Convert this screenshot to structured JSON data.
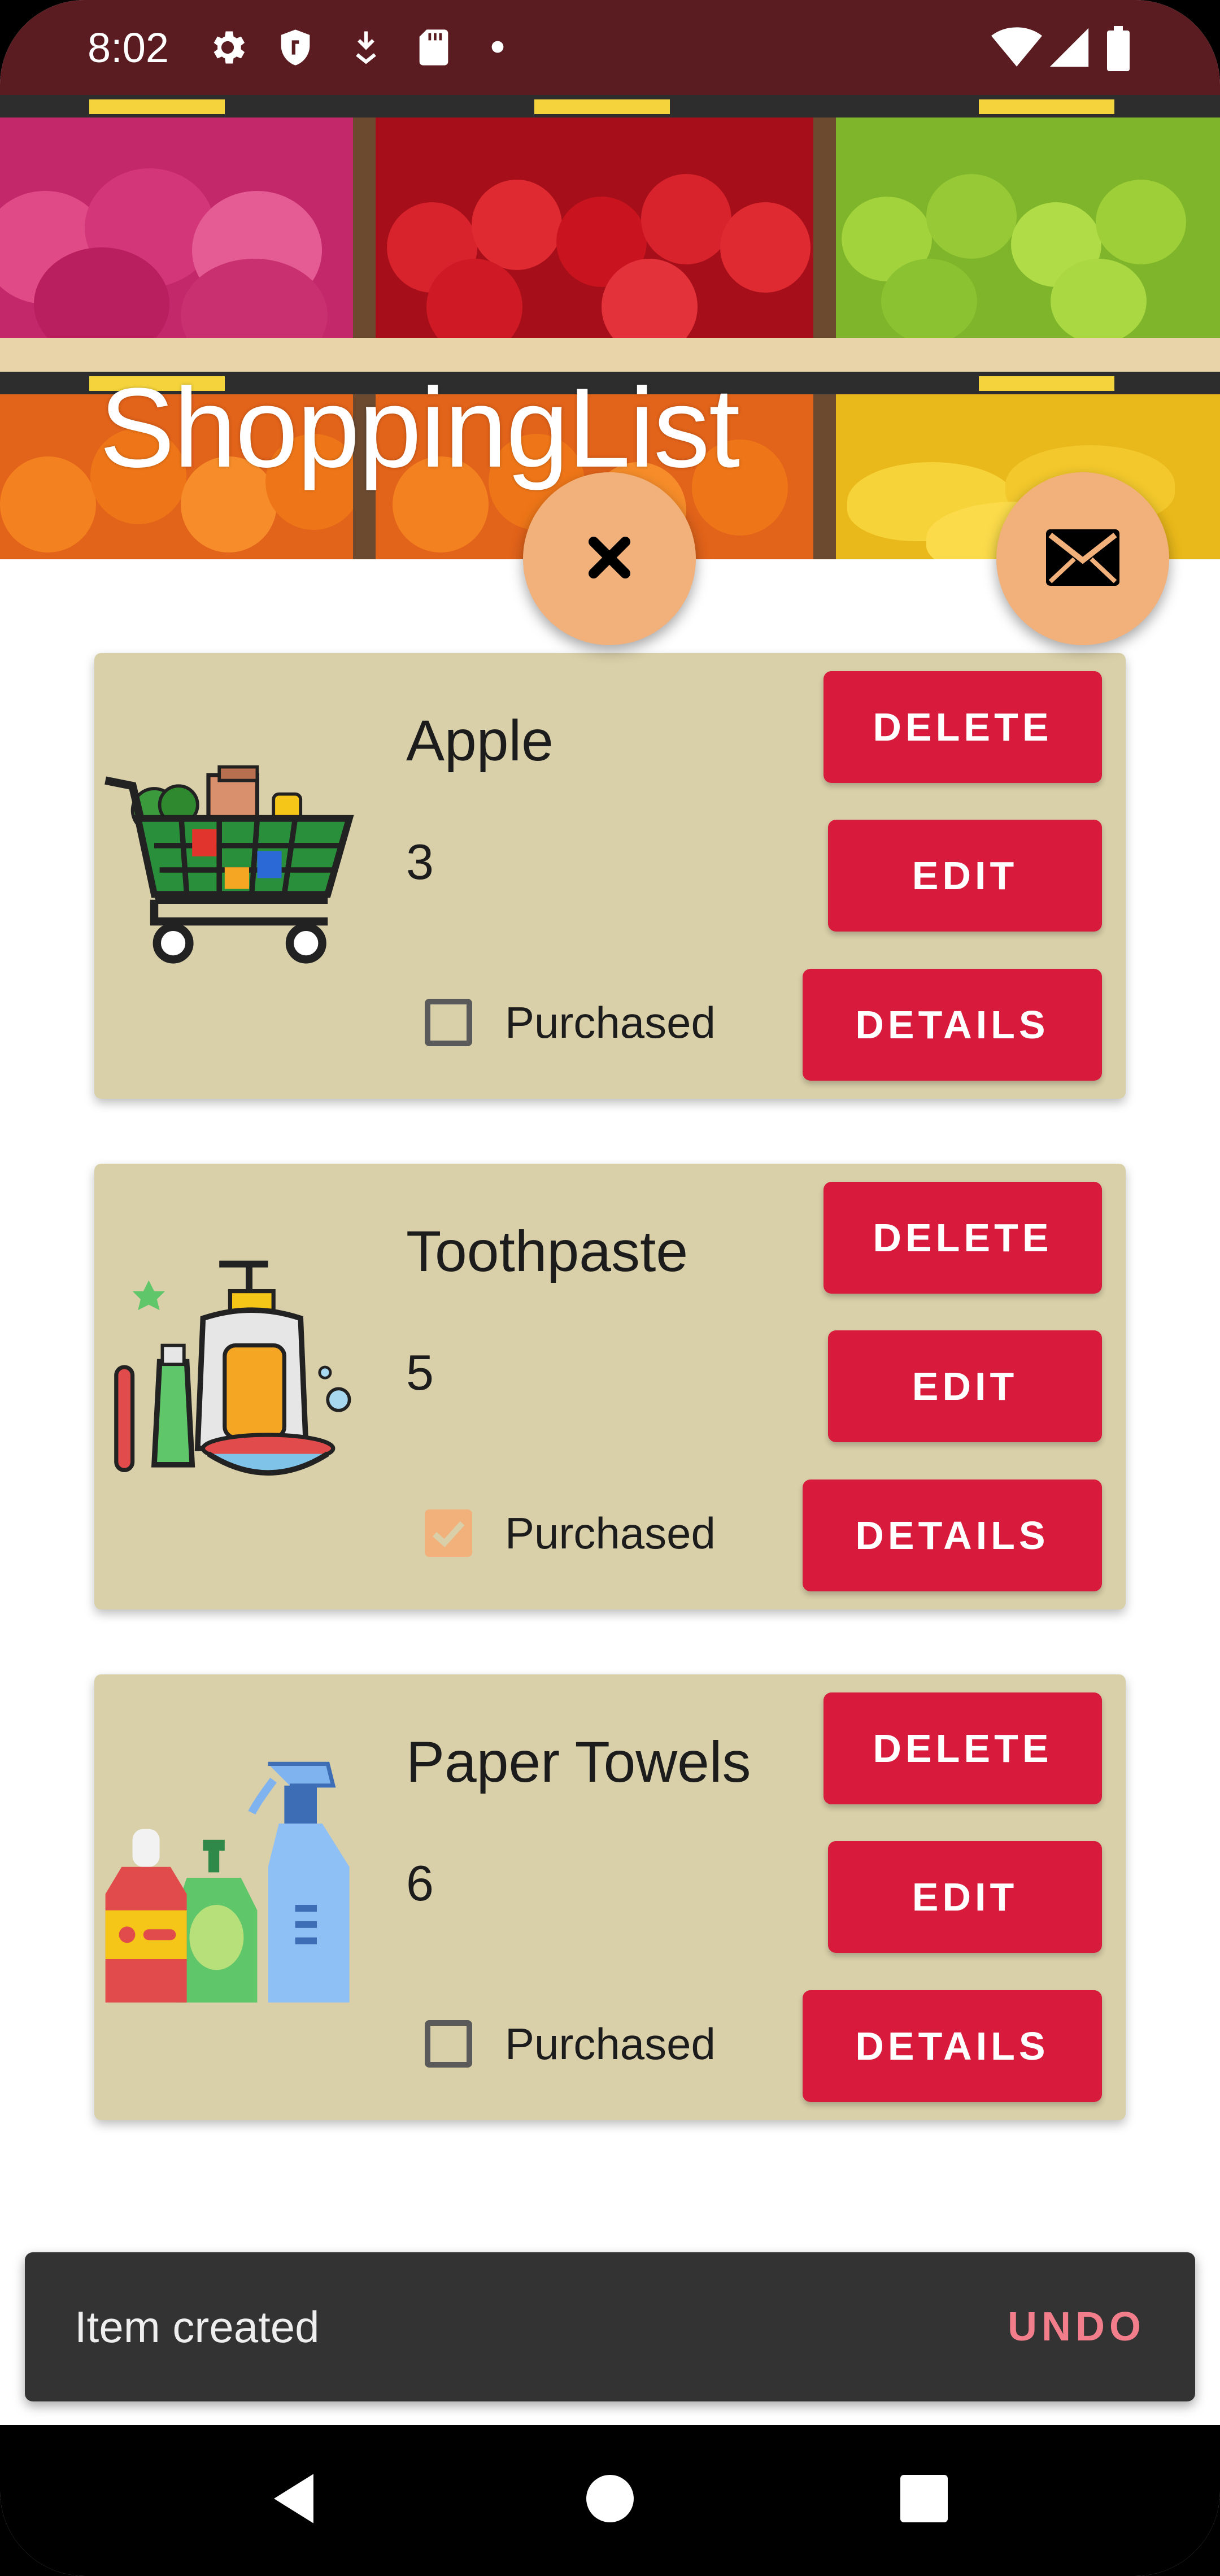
{
  "status_bar": {
    "time": "8:02",
    "icons_left": [
      "gear-icon",
      "shield-icon",
      "download-icon",
      "sd-card-icon",
      "dot-icon"
    ],
    "icons_right": [
      "wifi-icon",
      "signal-icon",
      "battery-icon"
    ]
  },
  "header": {
    "title": "ShoppingList",
    "background": "grocery-shelves-image"
  },
  "fabs": {
    "clear": {
      "icon": "close-icon"
    },
    "email": {
      "icon": "mail-icon"
    }
  },
  "items": [
    {
      "name": "Apple",
      "quantity": "3",
      "purchased_label": "Purchased",
      "purchased": false,
      "image": "shopping-cart-image",
      "delete_label": "DELETE",
      "edit_label": "EDIT",
      "details_label": "DETAILS"
    },
    {
      "name": "Toothpaste",
      "quantity": "5",
      "purchased_label": "Purchased",
      "purchased": true,
      "image": "toiletries-image",
      "delete_label": "DELETE",
      "edit_label": "EDIT",
      "details_label": "DETAILS"
    },
    {
      "name": "Paper Towels",
      "quantity": "6",
      "purchased_label": "Purchased",
      "purchased": false,
      "image": "cleaning-supplies-image",
      "delete_label": "DELETE",
      "edit_label": "EDIT",
      "details_label": "DETAILS"
    }
  ],
  "snackbar": {
    "message": "Item created",
    "action": "UNDO"
  },
  "nav_bar": {
    "buttons": [
      "back-icon",
      "home-icon",
      "recents-icon"
    ]
  },
  "colors": {
    "status_bar": "#5a1c20",
    "card_background": "#d9d0a9",
    "button": "#d81b3c",
    "fab": "#f2b07b",
    "snackbar": "#333333",
    "snackbar_action": "#f27e8c"
  }
}
